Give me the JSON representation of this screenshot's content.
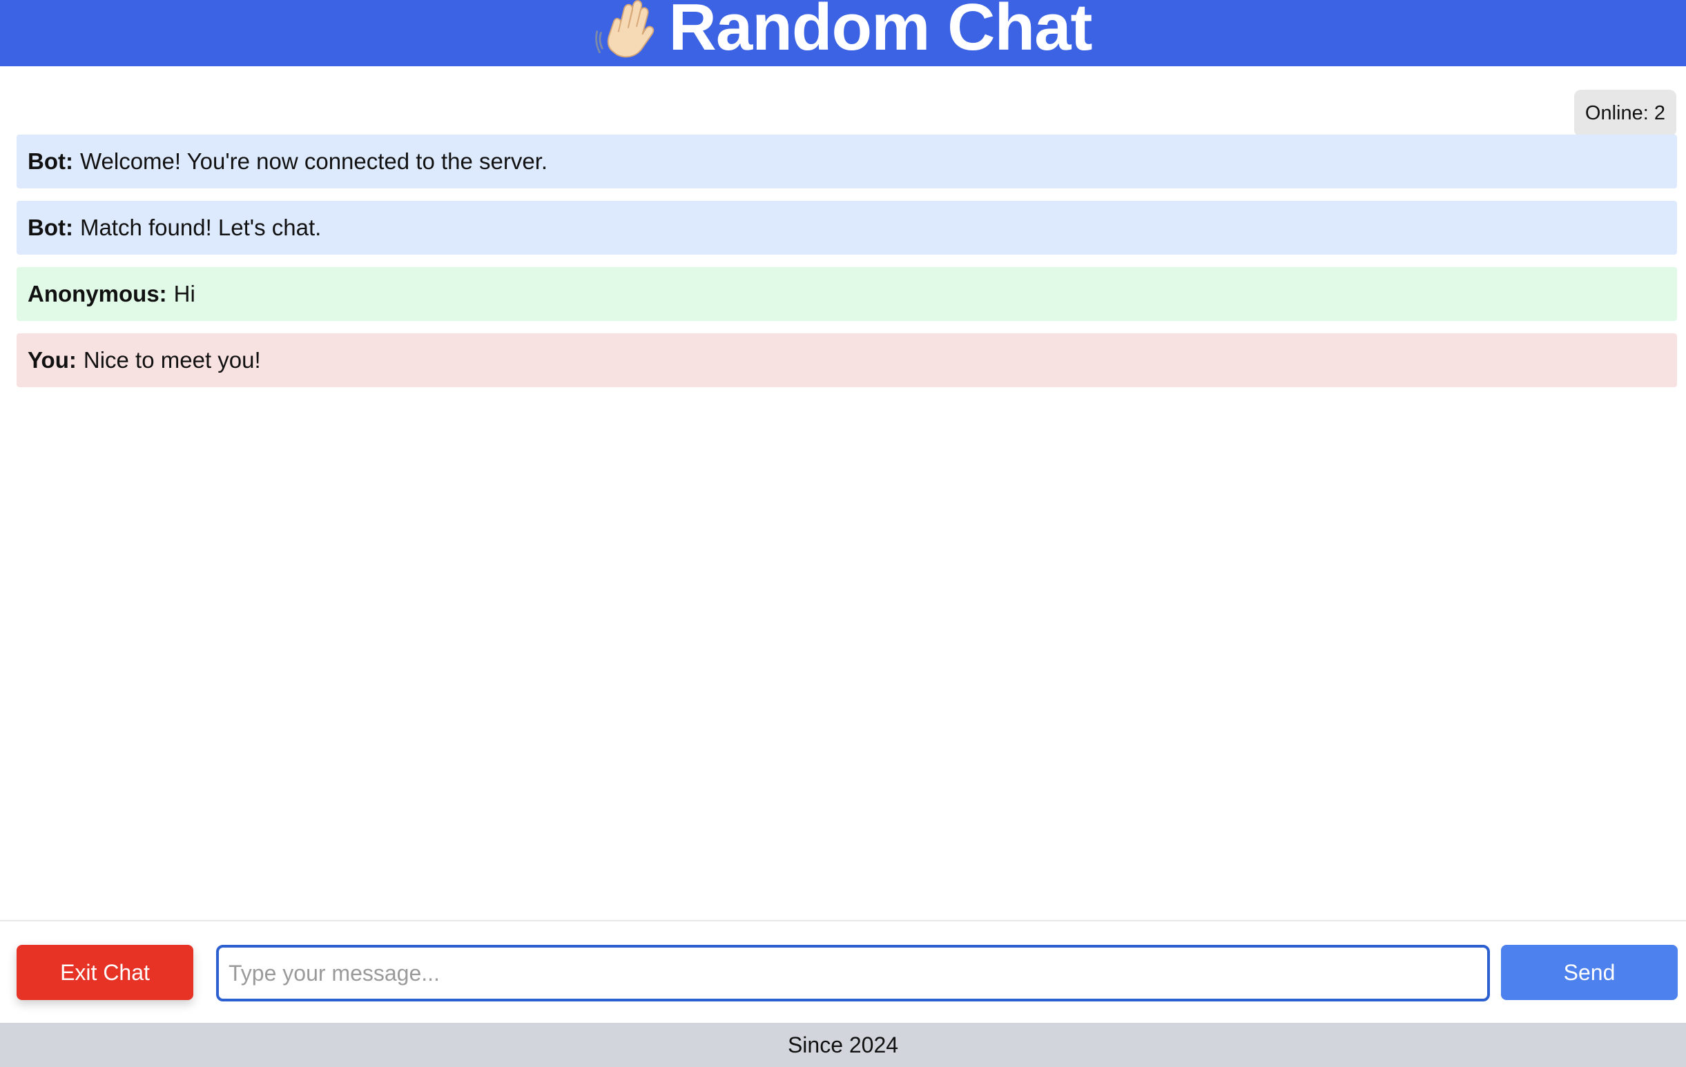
{
  "header": {
    "icon": "waving-hand-icon",
    "title": "Random Chat",
    "background_color": "#3b63e3"
  },
  "status": {
    "online_label": "Online: 2"
  },
  "messages": [
    {
      "sender": "Bot:",
      "text": "Welcome! You're now connected to the server.",
      "kind": "bot",
      "color": "#dde9fd"
    },
    {
      "sender": "Bot:",
      "text": "Match found! Let's chat.",
      "kind": "bot",
      "color": "#dde9fd"
    },
    {
      "sender": "Anonymous:",
      "text": "Hi",
      "kind": "stranger",
      "color": "#e1f9e7"
    },
    {
      "sender": "You:",
      "text": "Nice to meet you!",
      "kind": "self",
      "color": "#f8e2e1"
    }
  ],
  "composer": {
    "exit_label": "Exit Chat",
    "input_placeholder": "Type your message...",
    "input_value": "",
    "send_label": "Send",
    "exit_color": "#e63325",
    "send_color": "#4c81ee"
  },
  "footer": {
    "text": "Since 2024"
  }
}
